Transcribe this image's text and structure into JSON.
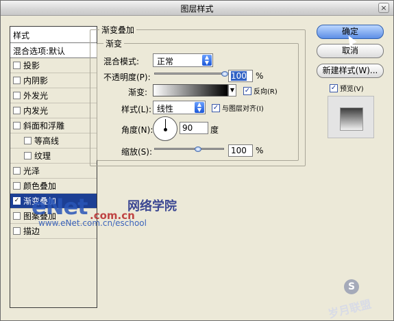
{
  "window": {
    "title": "图层样式",
    "close_symbol": "×"
  },
  "left_panel": {
    "header": "样式",
    "blend_options": "混合选项:默认",
    "items": [
      {
        "label": "投影",
        "checked": false,
        "indent": false
      },
      {
        "label": "内阴影",
        "checked": false,
        "indent": false
      },
      {
        "label": "外发光",
        "checked": false,
        "indent": false
      },
      {
        "label": "内发光",
        "checked": false,
        "indent": false
      },
      {
        "label": "斜面和浮雕",
        "checked": false,
        "indent": false
      },
      {
        "label": "等高线",
        "checked": false,
        "indent": true
      },
      {
        "label": "纹理",
        "checked": false,
        "indent": true
      },
      {
        "label": "光泽",
        "checked": false,
        "indent": false
      },
      {
        "label": "颜色叠加",
        "checked": false,
        "indent": false
      },
      {
        "label": "渐变叠加",
        "checked": true,
        "indent": false,
        "selected": true
      },
      {
        "label": "图案叠加",
        "checked": false,
        "indent": false
      },
      {
        "label": "描边",
        "checked": false,
        "indent": false
      }
    ]
  },
  "gradient_overlay": {
    "group_title": "渐变叠加",
    "sub_group_title": "渐变",
    "blend_mode_label": "混合模式:",
    "blend_mode_value": "正常",
    "opacity_label": "不透明度(P):",
    "opacity_value": "100",
    "opacity_fraction": 1.0,
    "percent": "%",
    "gradient_label": "渐变:",
    "reverse_label": "反向(R)",
    "reverse_checked": true,
    "style_label": "样式(L):",
    "style_value": "线性",
    "align_label": "与图层对齐(I)",
    "align_checked": true,
    "angle_label": "角度(N):",
    "angle_value": "90",
    "degree_unit": "度",
    "scale_label": "缩放(S):",
    "scale_value": "100",
    "scale_fraction": 0.5
  },
  "buttons": {
    "ok": "确定",
    "cancel": "取消",
    "new_style": "新建样式(W)...",
    "preview_label": "预览(V)",
    "preview_checked": true
  },
  "watermark": {
    "brand": "eNet",
    "domain": ".com.cn",
    "chinese": "网络学院",
    "url": "www.eNet.com.cn/eschool",
    "logo_text": "岁月联盟",
    "logo_letter": "S"
  },
  "colors": {
    "selection": "#1c3f94",
    "accent_button": "#5d8ee6"
  }
}
